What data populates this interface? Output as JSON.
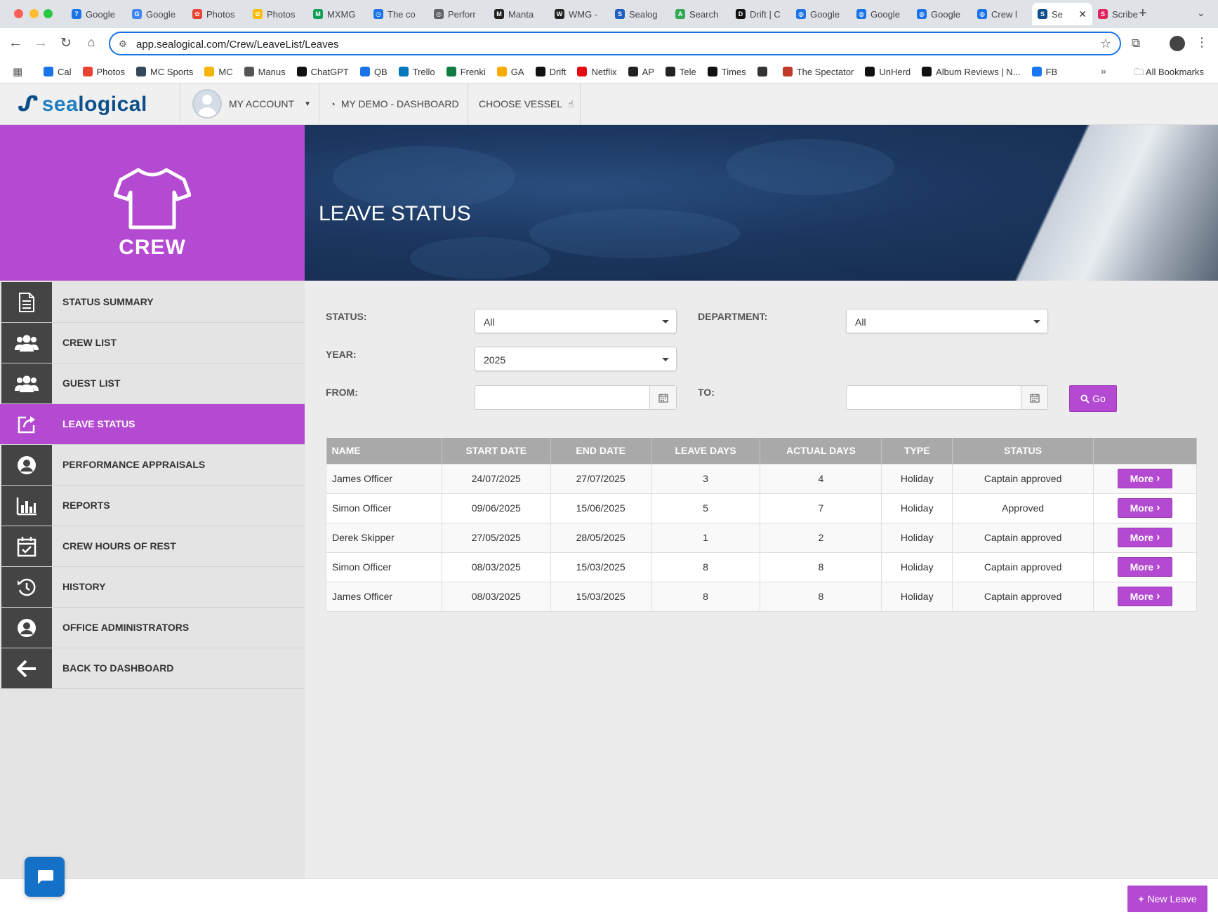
{
  "browser": {
    "tabs": [
      {
        "label": "Google",
        "color": "#1a73e8",
        "glyph": "7"
      },
      {
        "label": "Google",
        "color": "#4285f4",
        "glyph": "G"
      },
      {
        "label": "Photos",
        "color": "#ea4335",
        "glyph": "✿"
      },
      {
        "label": "Photos",
        "color": "#fbbc04",
        "glyph": "✿"
      },
      {
        "label": "MXMG",
        "color": "#0f9d58",
        "glyph": "M"
      },
      {
        "label": "The co",
        "color": "#1a73e8",
        "glyph": "◷"
      },
      {
        "label": "Perforr",
        "color": "#5f6368",
        "glyph": "◎"
      },
      {
        "label": "Manta",
        "color": "#222222",
        "glyph": "M"
      },
      {
        "label": "WMG -",
        "color": "#222222",
        "glyph": "W"
      },
      {
        "label": "Sealog",
        "color": "#1f5fbf",
        "glyph": "S"
      },
      {
        "label": "Search",
        "color": "#34a853",
        "glyph": "A"
      },
      {
        "label": "Drift | C",
        "color": "#111111",
        "glyph": "D"
      },
      {
        "label": "Google",
        "color": "#1a73e8",
        "glyph": "◍"
      },
      {
        "label": "Google",
        "color": "#1a73e8",
        "glyph": "◍"
      },
      {
        "label": "Google",
        "color": "#1a73e8",
        "glyph": "◍"
      },
      {
        "label": "Crew l",
        "color": "#1a73e8",
        "glyph": "◍"
      },
      {
        "label": "Se",
        "color": "#0d4f8b",
        "glyph": "S",
        "active": true
      },
      {
        "label": "Scribe",
        "color": "#e0245e",
        "glyph": "S"
      }
    ],
    "url": "app.sealogical.com/Crew/LeaveList/Leaves",
    "bookmarks": [
      {
        "label": "Cal",
        "color": "#1a73e8"
      },
      {
        "label": "Photos",
        "color": "#ea4335"
      },
      {
        "label": "MC Sports",
        "color": "#34495e"
      },
      {
        "label": "MC",
        "color": "#f4b400"
      },
      {
        "label": "Manus",
        "color": "#555555"
      },
      {
        "label": "ChatGPT",
        "color": "#111111"
      },
      {
        "label": "QB",
        "color": "#1a73e8"
      },
      {
        "label": "Trello",
        "color": "#0079bf"
      },
      {
        "label": "Frenki",
        "color": "#107c41"
      },
      {
        "label": "GA",
        "color": "#f9ab00"
      },
      {
        "label": "Drift",
        "color": "#111111"
      },
      {
        "label": "Netflix",
        "color": "#e50914"
      },
      {
        "label": "AP",
        "color": "#222222"
      },
      {
        "label": "Tele",
        "color": "#222222"
      },
      {
        "label": "Times",
        "color": "#111111"
      },
      {
        "label": "",
        "color": "#333333"
      },
      {
        "label": "The Spectator",
        "color": "#c0392b"
      },
      {
        "label": "UnHerd",
        "color": "#111111"
      },
      {
        "label": "Album Reviews | N...",
        "color": "#111111"
      },
      {
        "label": "FB",
        "color": "#1877f2"
      }
    ],
    "all_bookmarks": "All Bookmarks",
    "more_glyph": "»"
  },
  "header": {
    "logo_sea": "sea",
    "logo_rest": "logical",
    "account": "MY ACCOUNT",
    "dashboard": "MY DEMO - DASHBOARD",
    "vessel": "CHOOSE VESSEL"
  },
  "sidebar": {
    "module_title": "CREW",
    "items": [
      {
        "label": "STATUS SUMMARY",
        "icon": "document-icon"
      },
      {
        "label": "CREW LIST",
        "icon": "users-icon"
      },
      {
        "label": "GUEST LIST",
        "icon": "users-icon"
      },
      {
        "label": "LEAVE STATUS",
        "icon": "external-link-icon",
        "active": true
      },
      {
        "label": "PERFORMANCE APPRAISALS",
        "icon": "user-circle-icon"
      },
      {
        "label": "REPORTS",
        "icon": "bar-chart-icon"
      },
      {
        "label": "CREW HOURS OF REST",
        "icon": "calendar-check-icon"
      },
      {
        "label": "HISTORY",
        "icon": "history-icon"
      },
      {
        "label": "OFFICE ADMINISTRATORS",
        "icon": "user-circle-icon"
      },
      {
        "label": "BACK TO DASHBOARD",
        "icon": "arrow-left-icon"
      }
    ]
  },
  "page": {
    "title": "LEAVE STATUS"
  },
  "filters": {
    "status_label": "STATUS:",
    "status_value": "All",
    "department_label": "DEPARTMENT:",
    "department_value": "All",
    "year_label": "YEAR:",
    "year_value": "2025",
    "from_label": "FROM:",
    "from_value": "",
    "to_label": "TO:",
    "to_value": "",
    "go_label": "Go"
  },
  "table": {
    "headers": [
      "NAME",
      "START DATE",
      "END DATE",
      "LEAVE DAYS",
      "ACTUAL DAYS",
      "TYPE",
      "STATUS",
      ""
    ],
    "rows": [
      {
        "name": "James Officer",
        "start": "24/07/2025",
        "end": "27/07/2025",
        "leave_days": "3",
        "actual_days": "4",
        "type": "Holiday",
        "status": "Captain approved",
        "action": "More"
      },
      {
        "name": "Simon Officer",
        "start": "09/06/2025",
        "end": "15/06/2025",
        "leave_days": "5",
        "actual_days": "7",
        "type": "Holiday",
        "status": "Approved",
        "action": "More"
      },
      {
        "name": "Derek Skipper",
        "start": "27/05/2025",
        "end": "28/05/2025",
        "leave_days": "1",
        "actual_days": "2",
        "type": "Holiday",
        "status": "Captain approved",
        "action": "More"
      },
      {
        "name": "Simon Officer",
        "start": "08/03/2025",
        "end": "15/03/2025",
        "leave_days": "8",
        "actual_days": "8",
        "type": "Holiday",
        "status": "Captain approved",
        "action": "More"
      },
      {
        "name": "James Officer",
        "start": "08/03/2025",
        "end": "15/03/2025",
        "leave_days": "8",
        "actual_days": "8",
        "type": "Holiday",
        "status": "Captain approved",
        "action": "More"
      }
    ]
  },
  "footer": {
    "new_leave": "New Leave"
  },
  "colors": {
    "accent": "#b44ad1",
    "brand": "#0d4f8b",
    "chat": "#1570c8"
  }
}
